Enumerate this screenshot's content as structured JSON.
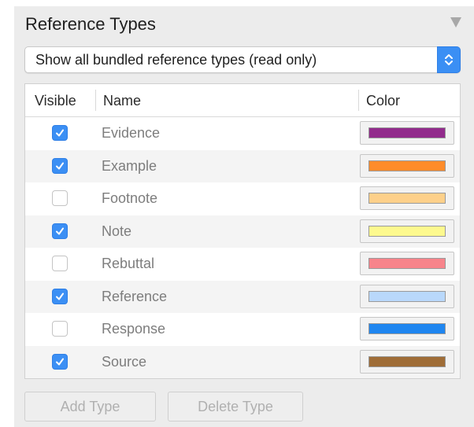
{
  "panel": {
    "title": "Reference Types",
    "collapse_icon": "triangle-down-icon"
  },
  "filter": {
    "selected": "Show all bundled reference types (read only)",
    "icon": "up-down-chevron-icon",
    "accent": "#3b8ff4"
  },
  "table": {
    "headers": [
      "Visible",
      "Name",
      "Color"
    ],
    "rows": [
      {
        "visible": true,
        "name": "Evidence",
        "color": "#922b8c"
      },
      {
        "visible": true,
        "name": "Example",
        "color": "#ff8c2a"
      },
      {
        "visible": false,
        "name": "Footnote",
        "color": "#fdd08a"
      },
      {
        "visible": true,
        "name": "Note",
        "color": "#fdf98e"
      },
      {
        "visible": false,
        "name": "Rebuttal",
        "color": "#f7848b"
      },
      {
        "visible": true,
        "name": "Reference",
        "color": "#b9d8fb"
      },
      {
        "visible": false,
        "name": "Response",
        "color": "#1f86f0"
      },
      {
        "visible": true,
        "name": "Source",
        "color": "#9f6d37"
      }
    ]
  },
  "buttons": {
    "add": "Add Type",
    "delete": "Delete Type"
  }
}
